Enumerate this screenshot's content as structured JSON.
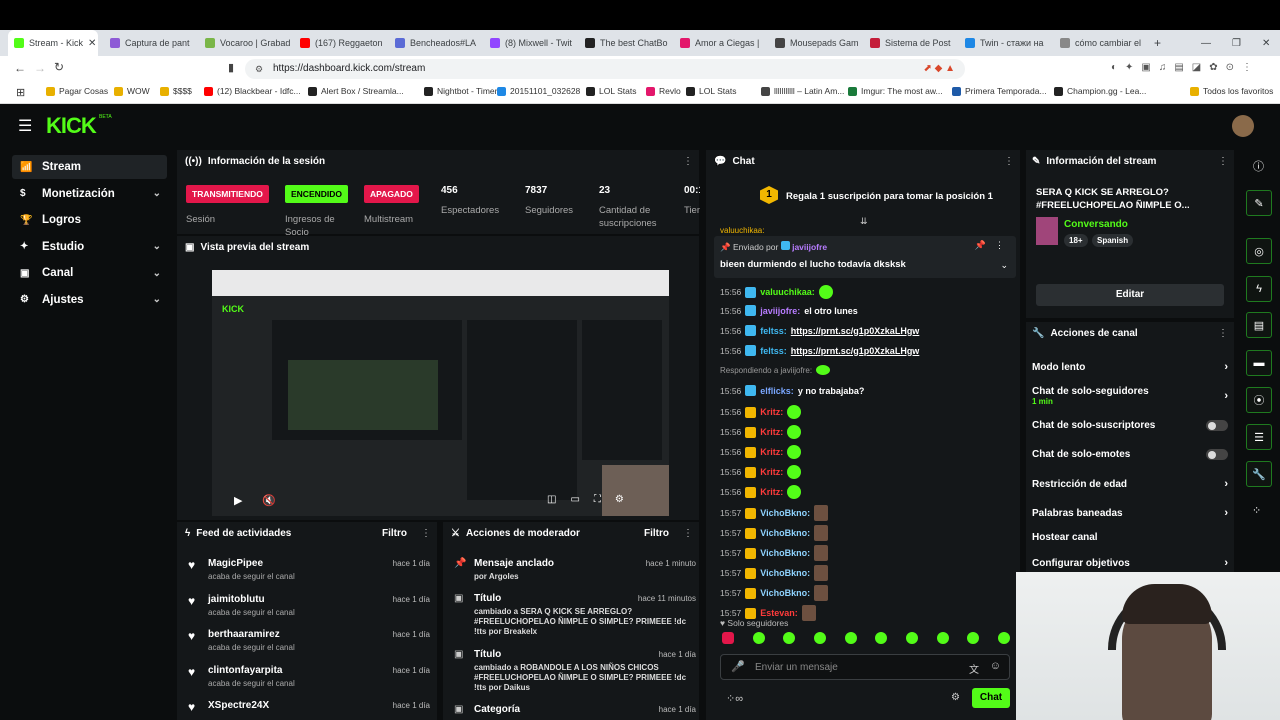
{
  "browser": {
    "tabs": [
      "Stream - Kick",
      "Captura de pant",
      "Vocaroo | Grabad",
      "(167) Reggaeton",
      "Bencheados#LA",
      "(8) Mixwell - Twit",
      "The best ChatBo",
      "Amor a Ciegas |",
      "Mousepads Gam",
      "Sistema de Post",
      "Twin - стажи на",
      "cómo cambiar el"
    ],
    "url": "https://dashboard.kick.com/stream",
    "bookmarks": [
      "Pagar Cosas",
      "WOW",
      "$$$$",
      "(12) Blackbear - Idfc...",
      "Alert Box / Streamla...",
      "Nightbot - Timers",
      "20151101_032628",
      "LOL Stats",
      "Revlo",
      "LOL Stats",
      "lllllllllll – Latin Am...",
      "Imgur: The most aw...",
      "Primera Temporada...",
      "Champion.gg - Lea...",
      "Todos los favoritos"
    ]
  },
  "sidebar": {
    "items": [
      {
        "label": "Stream",
        "icon": "signal-icon"
      },
      {
        "label": "Monetización",
        "icon": "money-icon"
      },
      {
        "label": "Logros",
        "icon": "trophy-icon"
      },
      {
        "label": "Estudio",
        "icon": "studio-icon"
      },
      {
        "label": "Canal",
        "icon": "channel-icon"
      },
      {
        "label": "Ajustes",
        "icon": "gear-icon"
      }
    ]
  },
  "session": {
    "title": "Información de la sesión",
    "badges": [
      {
        "text": "TRANSMITIENDO",
        "label": "Sesión",
        "color": "#e3174a"
      },
      {
        "text": "ENCENDIDO",
        "label": "Ingresos de Socio",
        "color": "#53fc18"
      },
      {
        "text": "APAGADO",
        "label": "Multistream",
        "color": "#e3174a"
      }
    ],
    "stats": [
      {
        "value": "456",
        "label": "Espectadores"
      },
      {
        "value": "7837",
        "label": "Seguidores"
      },
      {
        "value": "23",
        "label": "Cantidad de suscripciones"
      },
      {
        "value": "00:1",
        "label": "Tiem en vi"
      }
    ]
  },
  "preview": {
    "title": "Vista previa del stream"
  },
  "feed": {
    "title": "Feed de actividades",
    "filter": "Filtro",
    "items": [
      {
        "name": "MagicPipee",
        "sub": "acaba de seguir el canal",
        "time": "hace 1 día"
      },
      {
        "name": "jaimitoblutu",
        "sub": "acaba de seguir el canal",
        "time": "hace 1 día"
      },
      {
        "name": "berthaaramirez",
        "sub": "acaba de seguir el canal",
        "time": "hace 1 día"
      },
      {
        "name": "clintonfayarpita",
        "sub": "acaba de seguir el canal",
        "time": "hace 1 día"
      },
      {
        "name": "XSpectre24X",
        "sub": "",
        "time": "hace 1 día"
      }
    ]
  },
  "mod": {
    "title": "Acciones de moderador",
    "filter": "Filtro",
    "items": [
      {
        "title": "Mensaje anclado",
        "desc": "por Argoles",
        "time": "hace 1 minuto"
      },
      {
        "title": "Título",
        "desc": "cambiado a SERA Q KICK SE ARREGLO? #FREELUCHOPELAO ÑIMPLE O SIMPLE? PRIMEEE !dc !tts por Breakelx",
        "time": "hace 11 minutos"
      },
      {
        "title": "Título",
        "desc": "cambiado a ROBANDOLE A LOS NIÑOS CHICOS #FREELUCHOPELAO ÑIMPLE O SIMPLE? PRIMEEE !dc !tts por Daikus",
        "time": "hace 1 día"
      },
      {
        "title": "Categoría",
        "desc": "",
        "time": "hace 1 día"
      }
    ]
  },
  "chat": {
    "title": "Chat",
    "gift_banner": "Regala 1 suscripción para tomar la posición 1",
    "gift_rank": "1",
    "partial_top": "valuuchikaa:",
    "pinned": {
      "by_prefix": "Enviado por",
      "by": "javiijofre",
      "text": "bieen durmiendo el lucho todavía dksksk"
    },
    "messages": [
      {
        "time": "15:56",
        "user": "valuuchikaa:",
        "text": "",
        "color": "#53fc18"
      },
      {
        "time": "15:56",
        "user": "javiijofre:",
        "text": "el otro lunes",
        "color": "#b77cff"
      },
      {
        "time": "15:56",
        "user": "feltss:",
        "text": "https://prnt.sc/g1p0XzkaLHgw",
        "color": "#3fb8f0"
      },
      {
        "time": "15:56",
        "user": "feltss:",
        "text": "https://prnt.sc/g1p0XzkaLHgw",
        "color": "#3fb8f0"
      },
      {
        "time": "",
        "user": "Respondiendo a javiijofre:",
        "text": "",
        "color": "#999"
      },
      {
        "time": "15:56",
        "user": "elflicks:",
        "text": "y no trabajaba?",
        "color": "#7aa7ff"
      },
      {
        "time": "15:56",
        "user": "Kritz:",
        "text": "",
        "color": "#ff3b3b"
      },
      {
        "time": "15:56",
        "user": "Kritz:",
        "text": "",
        "color": "#ff3b3b"
      },
      {
        "time": "15:56",
        "user": "Kritz:",
        "text": "",
        "color": "#ff3b3b"
      },
      {
        "time": "15:56",
        "user": "Kritz:",
        "text": "",
        "color": "#ff3b3b"
      },
      {
        "time": "15:56",
        "user": "Kritz:",
        "text": "",
        "color": "#ff3b3b"
      },
      {
        "time": "15:57",
        "user": "VichoBkno:",
        "text": "",
        "color": "#8fd3ff"
      },
      {
        "time": "15:57",
        "user": "VichoBkno:",
        "text": "",
        "color": "#8fd3ff"
      },
      {
        "time": "15:57",
        "user": "VichoBkno:",
        "text": "",
        "color": "#8fd3ff"
      },
      {
        "time": "15:57",
        "user": "VichoBkno:",
        "text": "",
        "color": "#8fd3ff"
      },
      {
        "time": "15:57",
        "user": "VichoBkno:",
        "text": "",
        "color": "#8fd3ff"
      },
      {
        "time": "15:57",
        "user": "Estevan:",
        "text": "",
        "color": "#ff3b3b"
      }
    ],
    "mode": "Solo seguidores",
    "placeholder": "Enviar un mensaje",
    "send": "Chat"
  },
  "stream_info": {
    "title": "Información del stream",
    "stream_title": "SERA Q KICK SE ARREGLO? #FREELUCHOPELAO ÑIMPLE O...",
    "category": "Conversando",
    "tags": [
      "18+",
      "Spanish"
    ],
    "edit": "Editar"
  },
  "channel_actions": {
    "title": "Acciones de canal",
    "items": [
      {
        "label": "Modo lento",
        "sub": "",
        "kind": "arrow"
      },
      {
        "label": "Chat de solo-seguidores",
        "sub": "1 min",
        "kind": "arrow"
      },
      {
        "label": "Chat de solo-suscriptores",
        "sub": "",
        "kind": "toggle"
      },
      {
        "label": "Chat de solo-emotes",
        "sub": "",
        "kind": "toggle"
      },
      {
        "label": "Restricción de edad",
        "sub": "",
        "kind": "arrow"
      },
      {
        "label": "Palabras baneadas",
        "sub": "",
        "kind": "arrow"
      },
      {
        "label": "Hostear canal",
        "sub": "",
        "kind": "none"
      },
      {
        "label": "Configurar objetivos",
        "sub": "",
        "kind": "arrow"
      }
    ]
  },
  "colors": {
    "accent": "#53fc18",
    "live": "#e3174a",
    "panel": "#141719",
    "bg": "#0b0d0e"
  }
}
